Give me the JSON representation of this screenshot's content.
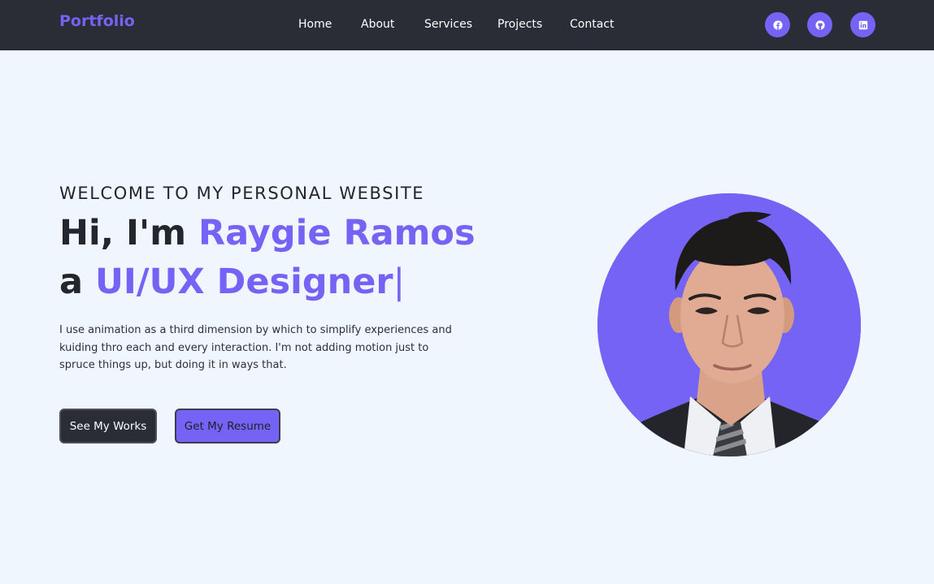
{
  "nav": {
    "brand": "Portfolio",
    "links": [
      "Home",
      "About",
      "Services",
      "Projects",
      "Contact"
    ],
    "social": [
      {
        "icon": "facebook-icon"
      },
      {
        "icon": "github-icon"
      },
      {
        "icon": "linkedin-icon"
      }
    ]
  },
  "hero": {
    "welcome": "WELCOME TO MY PERSONAL WEBSITE",
    "greeting_prefix": "Hi, I'm ",
    "name": "Raygie Ramos",
    "role_prefix": "a ",
    "role": "UI/UX Designer",
    "cursor": "|",
    "description": "I use animation as a third dimension by which to simplify experiences and kuiding thro each and every interaction. I'm not adding motion just to spruce things up, but doing it in ways that.",
    "buttons": {
      "works": "See My Works",
      "resume": "Get My Resume"
    }
  },
  "colors": {
    "accent": "#7563f6",
    "navbar": "#2a2d36",
    "background": "#eff6fd",
    "text": "#23262c"
  }
}
